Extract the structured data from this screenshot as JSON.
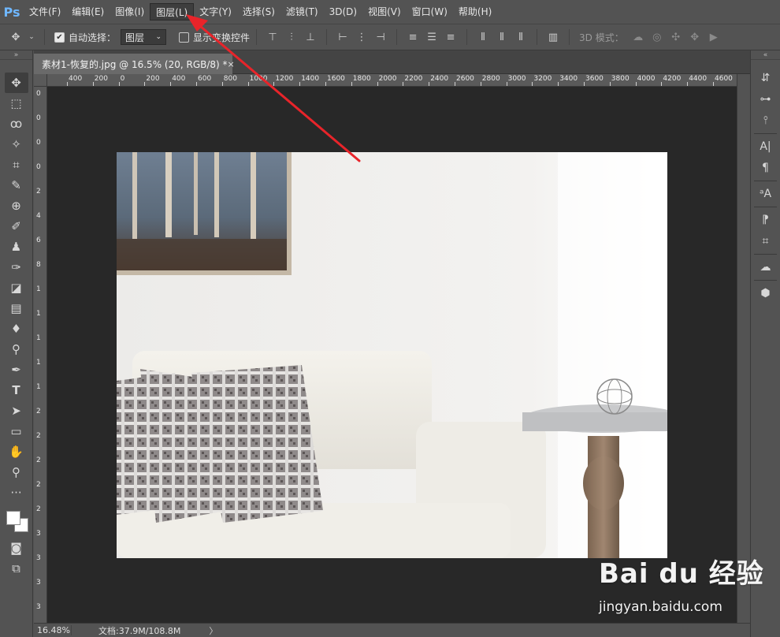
{
  "app": {
    "logo": "Ps"
  },
  "menu": {
    "items": [
      {
        "label": "文件(F)"
      },
      {
        "label": "编辑(E)"
      },
      {
        "label": "图像(I)"
      },
      {
        "label": "图层(L)"
      },
      {
        "label": "文字(Y)"
      },
      {
        "label": "选择(S)"
      },
      {
        "label": "滤镜(T)"
      },
      {
        "label": "3D(D)"
      },
      {
        "label": "视图(V)"
      },
      {
        "label": "窗口(W)"
      },
      {
        "label": "帮助(H)"
      }
    ]
  },
  "options": {
    "auto_select_label": "自动选择：",
    "auto_select_checked": true,
    "auto_select_target": "图层",
    "show_transform_label": "显示变换控件",
    "show_transform_checked": false,
    "mode_3d_label": "3D 模式："
  },
  "document": {
    "tab_title": "素材1-恢复的.jpg @ 16.5% (20, RGB/8) *",
    "close_symbol": "×"
  },
  "ruler": {
    "horizontal_labels": [
      "400",
      "200",
      "0",
      "200",
      "400",
      "600",
      "800",
      "1000",
      "1200",
      "1400",
      "1600",
      "1800",
      "2000",
      "2200",
      "2400",
      "2600",
      "2800",
      "3000",
      "3200",
      "3400",
      "3600",
      "3800",
      "4000",
      "4200",
      "4400",
      "4600"
    ],
    "vertical_labels": [
      "0",
      "0",
      "0",
      "0",
      "2",
      "4",
      "6",
      "8",
      "1",
      "1",
      "1",
      "1",
      "1",
      "2",
      "2",
      "2",
      "2",
      "2",
      "3",
      "3",
      "3",
      "3"
    ]
  },
  "status": {
    "zoom": "16.48%",
    "doc_size": "文档:37.9M/108.8M",
    "arrow": "〉"
  },
  "watermark": {
    "logo_text": "Bai du 经验",
    "url": "jingyan.baidu.com"
  },
  "colors": {
    "ui_bg": "#535353",
    "canvas_bg": "#282828",
    "annotation_arrow": "#e8242a",
    "ps_logo": "#6fb7ff"
  }
}
